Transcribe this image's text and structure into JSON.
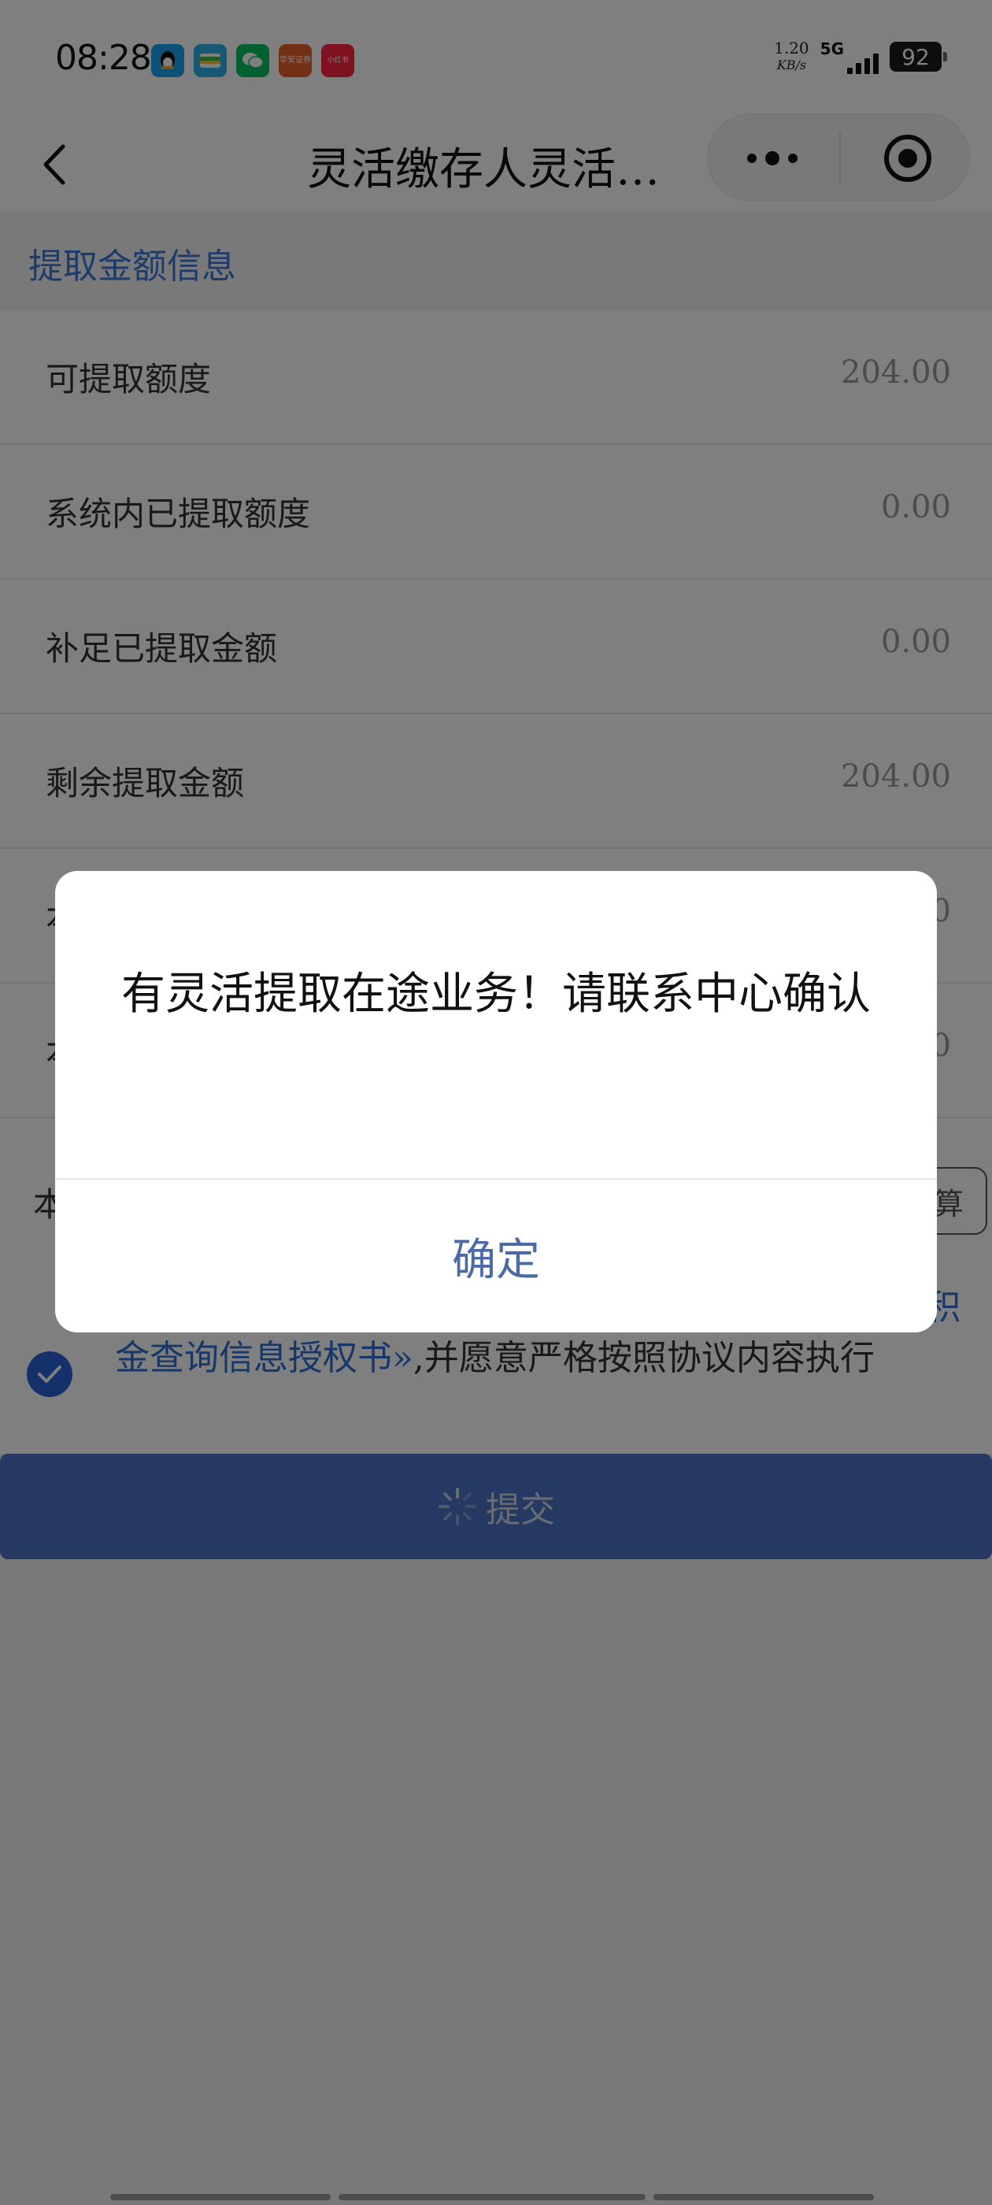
{
  "status_bar": {
    "time": "08:28",
    "notif_icons": [
      {
        "name": "qq-icon",
        "label": "",
        "color": "#1aa0f0"
      },
      {
        "name": "wallet-icon",
        "label": "",
        "color": "#2fb3e8"
      },
      {
        "name": "wechat-icon",
        "label": "",
        "color": "#07c160"
      },
      {
        "name": "securities-app-icon",
        "label": "华安证券",
        "color": "#e8602c"
      },
      {
        "name": "xiaohongshu-icon",
        "label": "小红书",
        "color": "#ff2442"
      }
    ],
    "net_speed": "1.20",
    "net_unit": "KB/s",
    "signal": "5G",
    "battery": "92"
  },
  "nav": {
    "title": "灵活缴存人灵活…"
  },
  "section": {
    "title": "提取金额信息"
  },
  "rows": [
    {
      "label": "可提取额度",
      "value": "204.00"
    },
    {
      "label": "系统内已提取额度",
      "value": "0.00"
    },
    {
      "label": "补足已提取金额",
      "value": "0.00"
    },
    {
      "label": "剩余提取金额",
      "value": "204.00"
    },
    {
      "label": "本",
      "value": "0"
    },
    {
      "label": "本",
      "value": "0"
    }
  ],
  "calc": {
    "label": "本",
    "button": "算"
  },
  "agreement": {
    "link_top": "积",
    "link": "金查询信息授权书»",
    "rest": ",并愿意严格按照协议内容执行"
  },
  "submit": {
    "label": "提交"
  },
  "dialog": {
    "message": "有灵活提取在途业务！请联系中心确认",
    "confirm": "确定"
  },
  "colors": {
    "accent": "#3a78d8",
    "submit": "#4a72c4",
    "dialog_button": "#4b6aa6"
  }
}
